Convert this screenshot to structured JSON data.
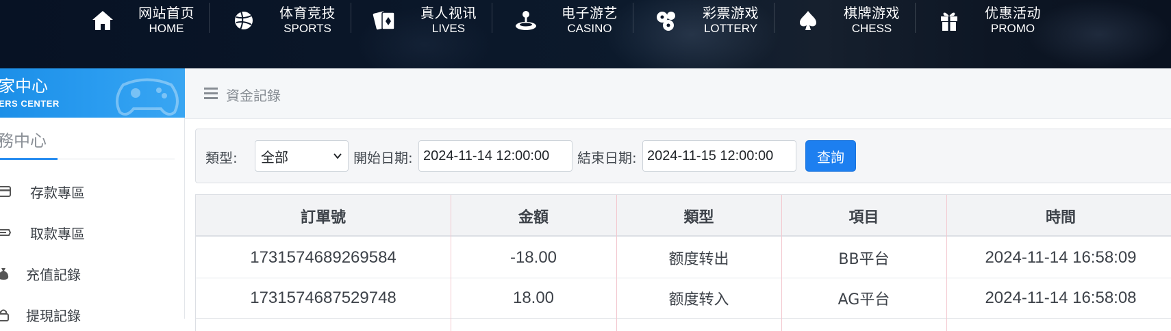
{
  "nav": {
    "items": [
      {
        "zh": "网站首页",
        "en": "HOME",
        "icon": "home-icon"
      },
      {
        "zh": "体育竞技",
        "en": "SPORTS",
        "icon": "ball-icon"
      },
      {
        "zh": "真人视讯",
        "en": "LIVES",
        "icon": "cards-icon"
      },
      {
        "zh": "电子游艺",
        "en": "CASINO",
        "icon": "joystick-icon"
      },
      {
        "zh": "彩票游戏",
        "en": "LOTTERY",
        "icon": "lottery-balls-icon"
      },
      {
        "zh": "棋牌游戏",
        "en": "CHESS",
        "icon": "spade-icon"
      },
      {
        "zh": "优惠活动",
        "en": "PROMO",
        "icon": "gift-icon"
      }
    ]
  },
  "sidebar": {
    "header_zh": "家中心",
    "header_en": "ERS CENTER",
    "section_title": "務中心",
    "items": [
      {
        "label": "存款專區",
        "icon": "deposit-card-icon"
      },
      {
        "label": "取款專區",
        "icon": "withdraw-icon"
      },
      {
        "label": "充值記錄",
        "icon": "money-bag-icon"
      },
      {
        "label": "提現記錄",
        "icon": "lock-icon"
      }
    ]
  },
  "main": {
    "breadcrumb": "資金記錄"
  },
  "filter": {
    "type_label": "類型:",
    "type_value": "全部",
    "start_label": "開始日期:",
    "start_value": "2024-11-14 12:00:00",
    "end_label": "結束日期:",
    "end_value": "2024-11-15 12:00:00",
    "query_label": "查詢"
  },
  "table": {
    "headers": [
      "訂單號",
      "金額",
      "類型",
      "項目",
      "時間"
    ],
    "rows": [
      [
        "1731574689269584",
        "-18.00",
        "额度转出",
        "BB平台",
        "2024-11-14 16:58:09"
      ],
      [
        "1731574687529748",
        "18.00",
        "额度转入",
        "AG平台",
        "2024-11-14 16:58:08"
      ]
    ]
  },
  "colors": {
    "accent": "#1d7ff0",
    "sidebar_header": "#2a9cf0",
    "column_divider": "#f3c8cf"
  }
}
